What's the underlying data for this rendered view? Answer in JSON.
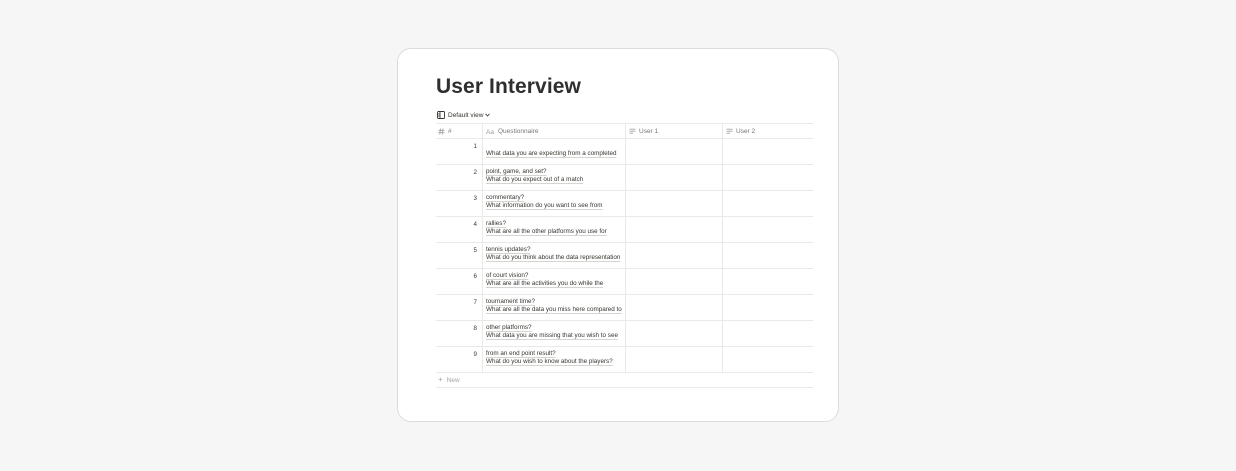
{
  "page": {
    "title": "User Interview",
    "view": {
      "label": "Default view",
      "icon": "table-view-icon"
    }
  },
  "table": {
    "columns": [
      {
        "label": "#",
        "icon": "number-icon"
      },
      {
        "label": "Questionnaire",
        "icon": "title-icon"
      },
      {
        "label": "User 1",
        "icon": "text-property-icon"
      },
      {
        "label": "User 2",
        "icon": "text-property-icon"
      }
    ],
    "rows": [
      {
        "num": "1",
        "question": "What data you are expecting from a completed point, game, and set?",
        "user1": "",
        "user2": ""
      },
      {
        "num": "2",
        "question": "What do you expect out of a match commentary?",
        "user1": "",
        "user2": ""
      },
      {
        "num": "3",
        "question": "What information do you want to see from rallies?",
        "user1": "",
        "user2": ""
      },
      {
        "num": "4",
        "question": "What are all the other platforms you use for tennis updates?",
        "user1": "",
        "user2": ""
      },
      {
        "num": "5",
        "question": "What do you think about the data representation of court vision?",
        "user1": "",
        "user2": ""
      },
      {
        "num": "6",
        "question": "What are all the activities you do while the tournament time?",
        "user1": "",
        "user2": ""
      },
      {
        "num": "7",
        "question": "What are all the data you miss here compared to other platforms?",
        "user1": "",
        "user2": ""
      },
      {
        "num": "8",
        "question": "What data you are missing that you wish to see from an end point result?",
        "user1": "",
        "user2": ""
      },
      {
        "num": "9",
        "question": "What do you wish to know about the players?",
        "user1": "",
        "user2": ""
      }
    ],
    "new_label": "New"
  },
  "colors": {
    "background": "#f6f6f6",
    "card": "#ffffff",
    "text": "#37352f",
    "muted": "#787774",
    "border": "#e9e9e7"
  }
}
